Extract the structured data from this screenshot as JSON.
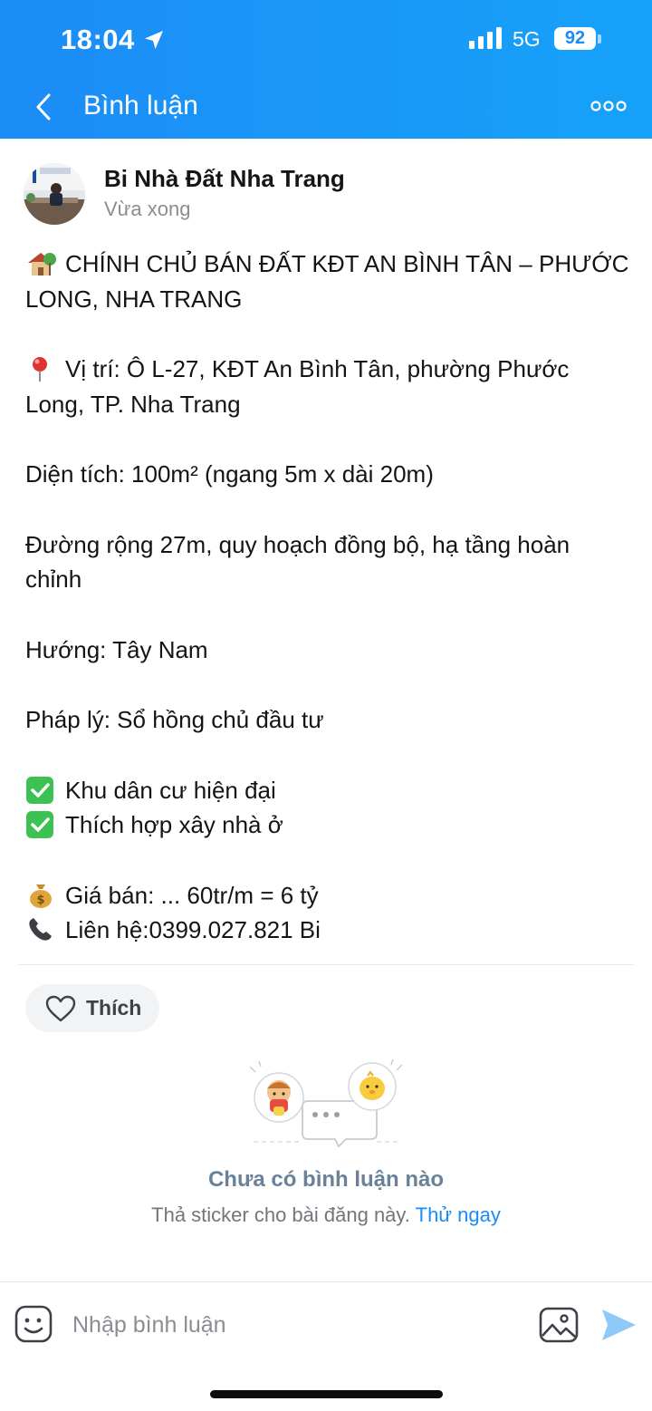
{
  "status_bar": {
    "time": "18:04",
    "network": "5G",
    "battery": "92"
  },
  "header": {
    "title": "Bình luận",
    "back_icon": "chevron-left-icon",
    "more_icon": "more-dots-icon"
  },
  "post": {
    "author": "Bi Nhà Đất Nha Trang",
    "time": "Vừa xong",
    "lines": [
      {
        "emoji": "house-icon",
        "text": "CHÍNH CHỦ BÁN ĐẤT KĐT AN BÌNH TÂN – PHƯỚC LONG, NHA TRANG"
      },
      {
        "emoji": "pin-icon",
        "text": "Vị trí: Ô L-27, KĐT An Bình Tân, phường Phước Long, TP. Nha Trang"
      },
      {
        "text": "Diện tích: 100m² (ngang 5m x dài 20m)"
      },
      {
        "text": "Đường rộng 27m, quy hoạch đồng bộ, hạ tầng hoàn chỉnh"
      },
      {
        "text": "Hướng: Tây Nam"
      },
      {
        "text": "Pháp lý: Sổ hồng chủ đầu tư"
      },
      {
        "emoji": "check-icon",
        "text": "Khu dân cư hiện đại"
      },
      {
        "emoji": "check-icon",
        "text": "Thích hợp xây nhà ở"
      },
      {
        "emoji": "money-bag-icon",
        "text": "Giá bán: ... 60tr/m = 6 tỷ"
      },
      {
        "emoji": "phone-icon",
        "text": "Liên hệ:0399.027.821 Bi"
      }
    ]
  },
  "like_button": {
    "label": "Thích"
  },
  "empty_state": {
    "title": "Chưa có bình luận nào",
    "subtitle": "Thả sticker cho bài đăng này.",
    "link": "Thử ngay"
  },
  "composer": {
    "placeholder": "Nhập bình luận"
  },
  "colors": {
    "header_start": "#1c8cf7",
    "header_end": "#16a2f9",
    "accent": "#1a8cf6",
    "check_green": "#3cc252"
  }
}
